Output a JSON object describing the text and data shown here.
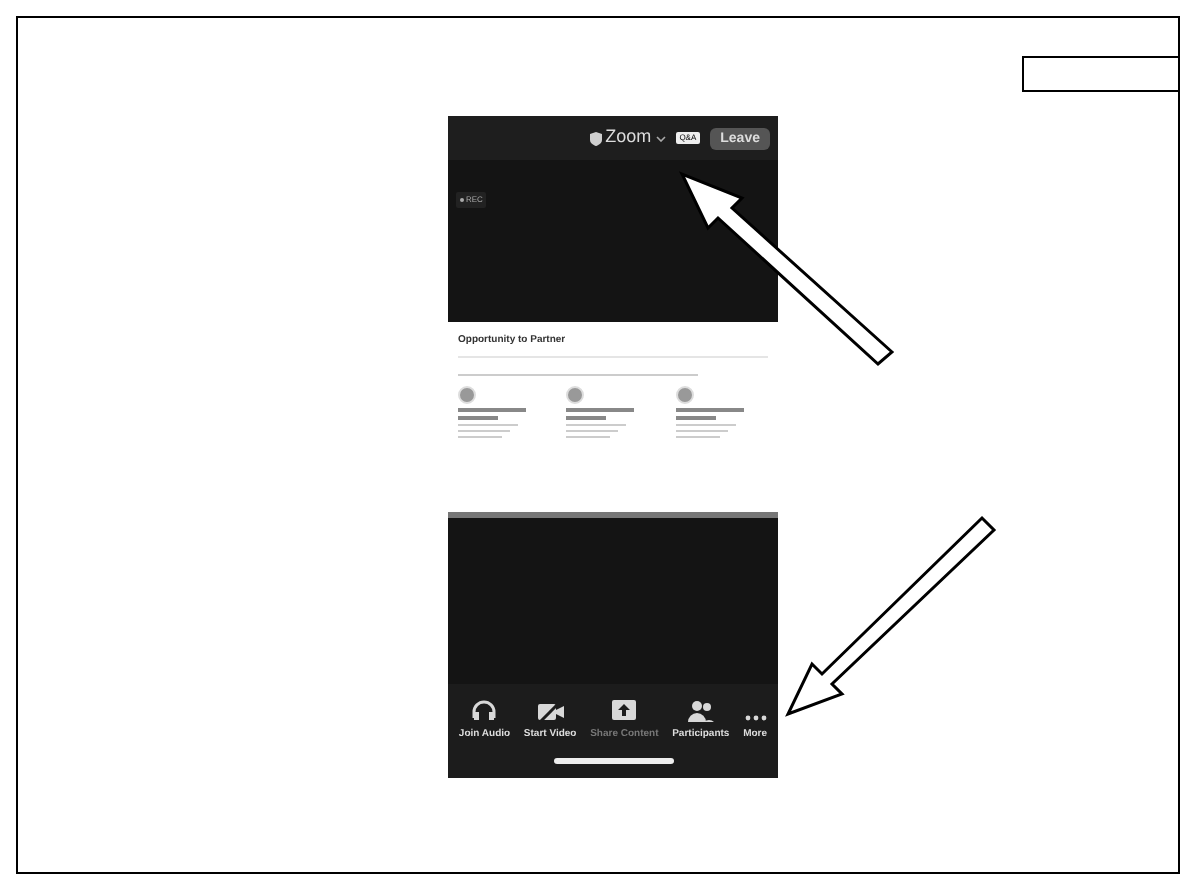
{
  "meeting": {
    "title": "Zoom",
    "qa_label": "Q&A",
    "leave_label": "Leave",
    "rec_label": "REC"
  },
  "slide": {
    "title": "Opportunity to Partner"
  },
  "toolbar": [
    {
      "kind": "audio",
      "label": "Join Audio",
      "disabled": false
    },
    {
      "kind": "video",
      "label": "Start Video",
      "disabled": false
    },
    {
      "kind": "share",
      "label": "Share Content",
      "disabled": true
    },
    {
      "kind": "participants",
      "label": "Participants",
      "disabled": false
    },
    {
      "kind": "more",
      "label": "More",
      "disabled": false
    }
  ]
}
